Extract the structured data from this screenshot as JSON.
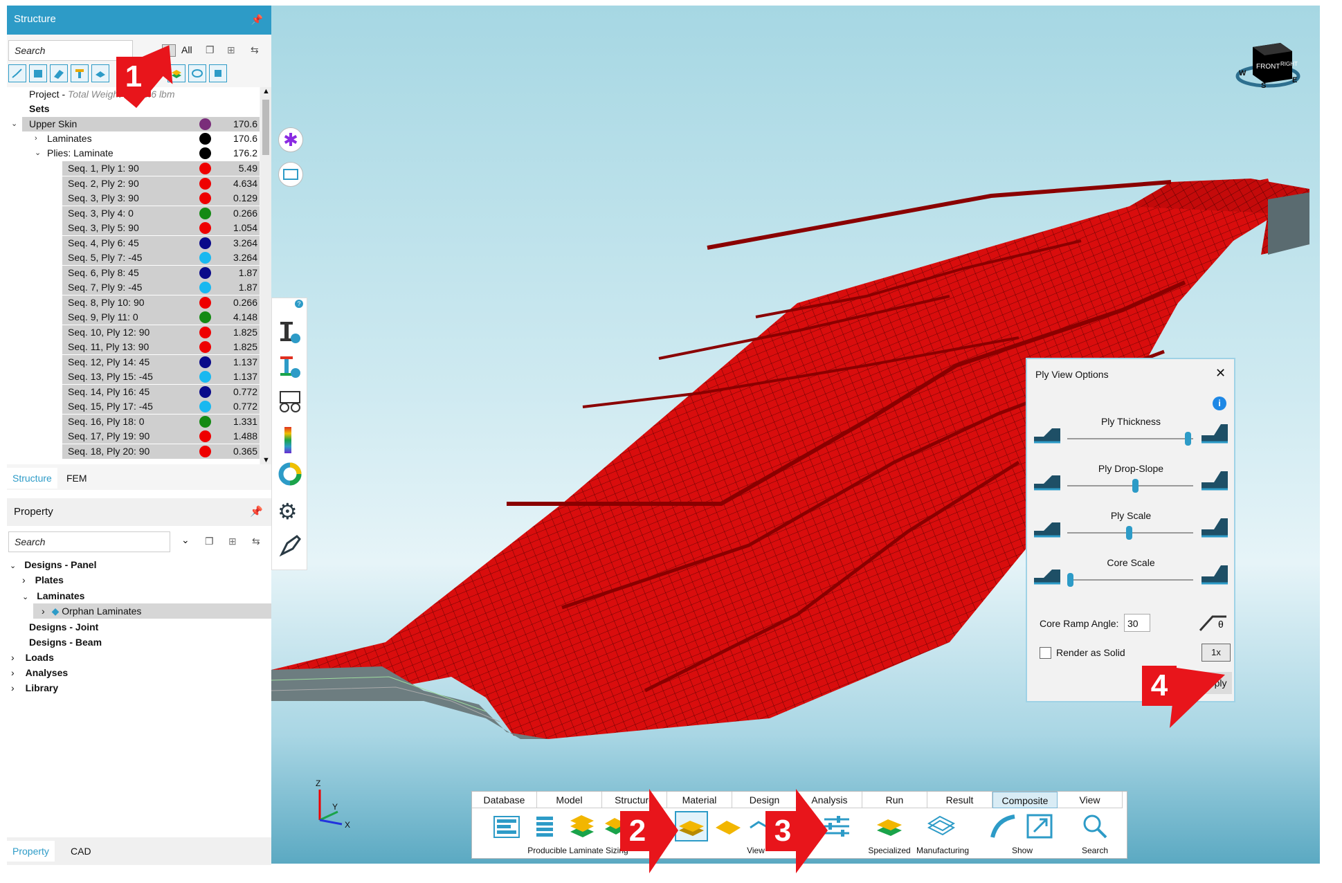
{
  "structure_panel": {
    "title": "Structure",
    "search_placeholder": "Search",
    "filter_all": "All",
    "tree": [
      {
        "label": "Project - ",
        "extra": "Total Weight = 190.6 lbm"
      },
      {
        "label": "Sets"
      },
      {
        "label": "Upper Skin",
        "color": "#7a2d7a",
        "value": "170.6"
      },
      {
        "label": "Laminates",
        "color": "#000000",
        "value": "170.6"
      },
      {
        "label": "Plies: Laminate",
        "color": "#000000",
        "value": "176.2"
      }
    ],
    "plies": [
      {
        "label": "Seq. 1, Ply 1: 90",
        "color": "#ee0000",
        "value": "5.49"
      },
      {
        "label": "Seq. 2, Ply 2: 90",
        "color": "#ee0000",
        "value": "4.634"
      },
      {
        "label": "Seq. 3, Ply 3: 90",
        "color": "#ee0000",
        "value": "0.129"
      },
      {
        "label": "Seq. 3, Ply 4: 0",
        "color": "#148a14",
        "value": "0.266"
      },
      {
        "label": "Seq. 3, Ply 5: 90",
        "color": "#ee0000",
        "value": "1.054"
      },
      {
        "label": "Seq. 4, Ply 6: 45",
        "color": "#0a0a8a",
        "value": "3.264"
      },
      {
        "label": "Seq. 5, Ply 7: -45",
        "color": "#18b8f0",
        "value": "3.264"
      },
      {
        "label": "Seq. 6, Ply 8: 45",
        "color": "#0a0a8a",
        "value": "1.87"
      },
      {
        "label": "Seq. 7, Ply 9: -45",
        "color": "#18b8f0",
        "value": "1.87"
      },
      {
        "label": "Seq. 8, Ply 10: 90",
        "color": "#ee0000",
        "value": "0.266"
      },
      {
        "label": "Seq. 9, Ply 11: 0",
        "color": "#148a14",
        "value": "4.148"
      },
      {
        "label": "Seq. 10, Ply 12: 90",
        "color": "#ee0000",
        "value": "1.825"
      },
      {
        "label": "Seq. 11, Ply 13: 90",
        "color": "#ee0000",
        "value": "1.825"
      },
      {
        "label": "Seq. 12, Ply 14: 45",
        "color": "#0a0a8a",
        "value": "1.137"
      },
      {
        "label": "Seq. 13, Ply 15: -45",
        "color": "#18b8f0",
        "value": "1.137"
      },
      {
        "label": "Seq. 14, Ply 16: 45",
        "color": "#0a0a8a",
        "value": "0.772"
      },
      {
        "label": "Seq. 15, Ply 17: -45",
        "color": "#18b8f0",
        "value": "0.772"
      },
      {
        "label": "Seq. 16, Ply 18: 0",
        "color": "#148a14",
        "value": "1.331"
      },
      {
        "label": "Seq. 17, Ply 19: 90",
        "color": "#ee0000",
        "value": "1.488"
      },
      {
        "label": "Seq. 18, Ply 20: 90",
        "color": "#ee0000",
        "value": "0.365"
      }
    ],
    "tabs": [
      "Structure",
      "FEM"
    ]
  },
  "property_panel": {
    "title": "Property",
    "search_placeholder": "Search",
    "tree": [
      "Designs - Panel",
      "Plates",
      "Laminates",
      "Orphan Laminates",
      "Designs - Joint",
      "Designs - Beam",
      "Loads",
      "Analyses",
      "Library"
    ],
    "tabs": [
      "Property",
      "CAD"
    ]
  },
  "view_cube": {
    "face_front": "FRONT",
    "face_right": "RIGHT",
    "compass": [
      "W",
      "S",
      "E"
    ]
  },
  "axes": {
    "z": "Z",
    "y": "Y",
    "x": "X"
  },
  "ply_view_options": {
    "title": "Ply View Options",
    "sliders": [
      {
        "label": "Ply Thickness",
        "value": 0.98
      },
      {
        "label": "Ply Drop-Slope",
        "value": 0.55
      },
      {
        "label": "Ply Scale",
        "value": 0.5
      },
      {
        "label": "Core Scale",
        "value": 0.02
      }
    ],
    "core_ramp_label": "Core Ramp Angle:",
    "core_ramp_value": "30",
    "render_as_solid": "Render as Solid",
    "render_as_solid_checked": false,
    "scale_button": "1x",
    "apply": "Apply"
  },
  "ribbon": {
    "tabs": [
      "Database",
      "Model",
      "Structure",
      "Material",
      "Design",
      "Analysis",
      "Run",
      "Result",
      "Composite",
      "View"
    ],
    "active_tab": "Composite",
    "groups": [
      "Producible Laminate Sizing",
      "View",
      "Specialized",
      "Manufacturing",
      "Show",
      "Search"
    ]
  },
  "callouts": [
    "1",
    "2",
    "3",
    "4"
  ],
  "colors": {
    "accent": "#2d9bc7",
    "mesh_red": "#d90d0d",
    "callout_red": "#e8151b"
  }
}
